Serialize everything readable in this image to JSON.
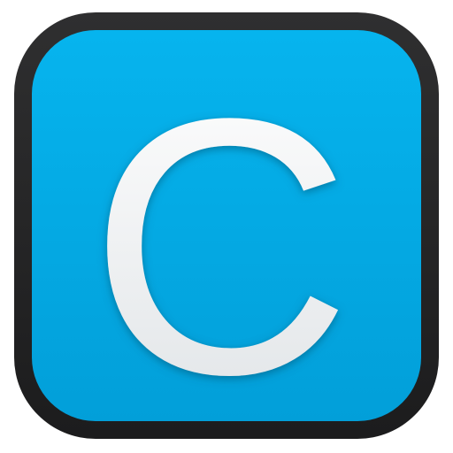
{
  "icon": {
    "name": "app-icon",
    "glyph": "C",
    "colors": {
      "border": "#2f2f30",
      "border_dark": "#1c1c1d",
      "fill_top": "#06b4ee",
      "fill_bottom": "#029fd9",
      "letter_top": "#ffffff",
      "letter_bottom": "#dfe3e6",
      "letter_shadow": "#0a4f6c",
      "background": "#ffffff"
    }
  }
}
